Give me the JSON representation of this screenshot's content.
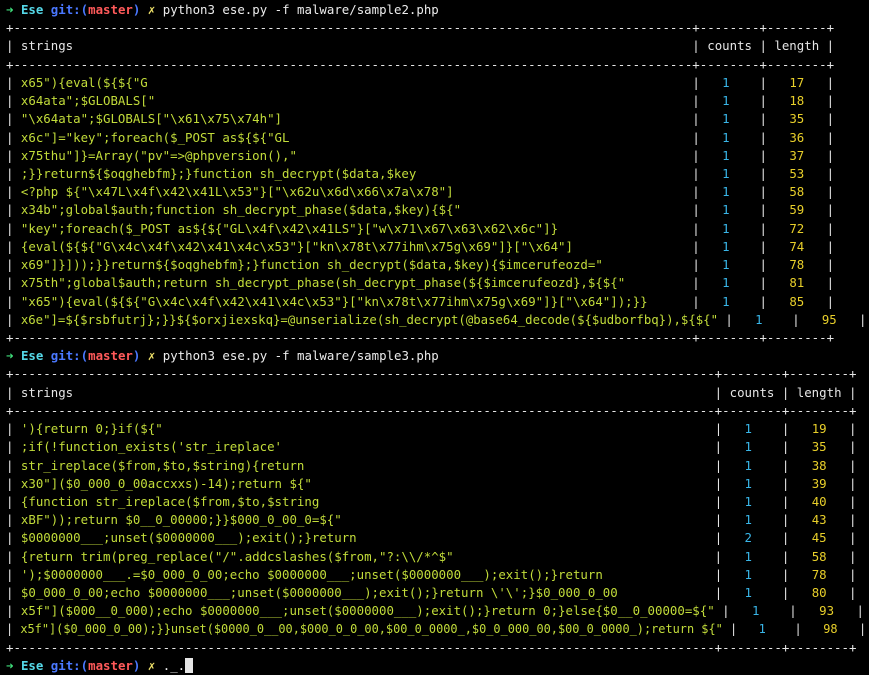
{
  "prompt": {
    "arrow": "➜",
    "dir": "Ese",
    "git_prefix": "git:(",
    "branch": "master",
    "git_suffix": ")",
    "dirty_mark": "✗"
  },
  "commands": [
    "python3 ese.py -f malware/sample2.php",
    "python3 ese.py -f malware/sample3.php",
    "._."
  ],
  "headers": {
    "strings": "strings",
    "counts": "counts",
    "length": "length"
  },
  "tables": [
    {
      "rows": [
        {
          "s": "x65\"){eval(${${\"G",
          "c": "1",
          "l": "17"
        },
        {
          "s": "x64ata\";$GLOBALS[\"",
          "c": "1",
          "l": "18"
        },
        {
          "s": "\"\\x64ata\";$GLOBALS[\"\\x61\\x75\\x74h\"]",
          "c": "1",
          "l": "35"
        },
        {
          "s": "x6c\"]=\"key\";foreach($_POST as${${\"GL",
          "c": "1",
          "l": "36"
        },
        {
          "s": "x75thu\"]}=Array(\"pv\"=>@phpversion(),\"",
          "c": "1",
          "l": "37"
        },
        {
          "s": ";}}return${$oqghebfm};}function sh_decrypt($data,$key",
          "c": "1",
          "l": "53"
        },
        {
          "s": "<?php ${\"\\x47L\\x4f\\x42\\x41L\\x53\"}[\"\\x62u\\x6d\\x66\\x7a\\x78\"]",
          "c": "1",
          "l": "58"
        },
        {
          "s": "x34b\";global$auth;function sh_decrypt_phase($data,$key){${\"",
          "c": "1",
          "l": "59"
        },
        {
          "s": "\"key\";foreach($_POST as${${\"GL\\x4f\\x42\\x41LS\"}[\"w\\x71\\x67\\x63\\x62\\x6c\"]}",
          "c": "1",
          "l": "72"
        },
        {
          "s": "{eval(${${\"G\\x4c\\x4f\\x42\\x41\\x4c\\x53\"}[\"kn\\x78t\\x77ihm\\x75g\\x69\"]}[\"\\x64\"]",
          "c": "1",
          "l": "74"
        },
        {
          "s": "x69\"]}]));}}return${$oqghebfm};}function sh_decrypt($data,$key){$imcerufeozd=\"",
          "c": "1",
          "l": "78"
        },
        {
          "s": "x75th\";global$auth;return sh_decrypt_phase(sh_decrypt_phase(${$imcerufeozd},${${\"",
          "c": "1",
          "l": "81"
        },
        {
          "s": "\"x65\"){eval(${${\"G\\x4c\\x4f\\x42\\x41\\x4c\\x53\"}[\"kn\\x78t\\x77ihm\\x75g\\x69\"]}[\"\\x64\"]);}}",
          "c": "1",
          "l": "85"
        },
        {
          "s": "x6e\"]=${$rsbfutrj};}}${$orxjiexskq}=@unserialize(sh_decrypt(@base64_decode(${$udborfbq}),${${\"",
          "c": "1",
          "l": "95"
        }
      ]
    },
    {
      "rows": [
        {
          "s": "'){return 0;}if(${\"",
          "c": "1",
          "l": "19"
        },
        {
          "s": ";if(!function_exists('str_ireplace'",
          "c": "1",
          "l": "35"
        },
        {
          "s": "str_ireplace($from,$to,$string){return",
          "c": "1",
          "l": "38"
        },
        {
          "s": "x30\"]($0_000_0_00accxxs)-14);return ${\"",
          "c": "1",
          "l": "39"
        },
        {
          "s": "{function str_ireplace($from,$to,$string",
          "c": "1",
          "l": "40"
        },
        {
          "s": "xBF\"));return $0__0_00000;}}$000_0_00_0=${\"",
          "c": "1",
          "l": "43"
        },
        {
          "s": "$0000000___;unset($0000000___);exit();}return",
          "c": "2",
          "l": "45"
        },
        {
          "s": "{return trim(preg_replace(\"/\".addcslashes($from,\"?:\\\\/*^$\"",
          "c": "1",
          "l": "58"
        },
        {
          "s": "');$0000000___.=$0_000_0_00;echo $0000000___;unset($0000000___);exit();}return",
          "c": "1",
          "l": "78"
        },
        {
          "s": "$0_000_0_00;echo $0000000___;unset($0000000___);exit();}return \\'\\';}$0_000_0_00",
          "c": "1",
          "l": "80"
        },
        {
          "s": "x5f\"]($000__0_000);echo $0000000___;unset($0000000___);exit();}return 0;}else{$0__0_00000=${\"",
          "c": "1",
          "l": "93"
        },
        {
          "s": "x5f\"]($0_000_0_00);}}unset($0000_0__00,$000_0_0_00,$00_0_0000_,$0_0_000_00,$00_0_0000_);return ${\"",
          "c": "1",
          "l": "98"
        }
      ]
    }
  ],
  "colors": {
    "background": "#000000",
    "prompt_arrow": "#3fdc7a",
    "prompt_dir": "#55d8e8",
    "git_label": "#4a78ff",
    "branch": "#ff5a5a",
    "dirty_mark": "#f0e36a",
    "strings": "#c2dc3a",
    "counts": "#39b6e8",
    "length": "#e8cf2a"
  }
}
